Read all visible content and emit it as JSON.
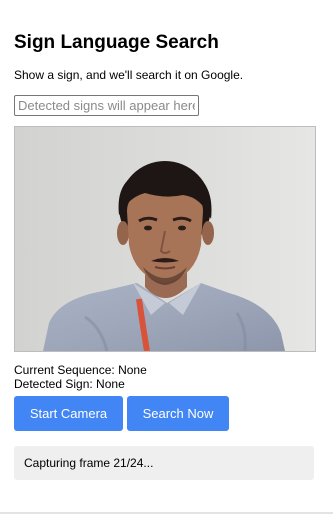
{
  "page": {
    "title": "Sign Language Search",
    "subtitle": "Show a sign, and we'll search it on Google."
  },
  "detected_input": {
    "value": "",
    "placeholder": "Detected signs will appear here"
  },
  "camera": {
    "feed": "live-camera-feed"
  },
  "info": {
    "current_sequence": "Current Sequence: None",
    "detected_sign": "Detected Sign: None"
  },
  "buttons": {
    "start_camera": "Start Camera",
    "search_now": "Search Now"
  },
  "status": {
    "text": "Capturing frame 21/24..."
  },
  "colors": {
    "button_bg": "#4285f4",
    "button_text": "#ffffff",
    "status_bg": "#efefef"
  }
}
